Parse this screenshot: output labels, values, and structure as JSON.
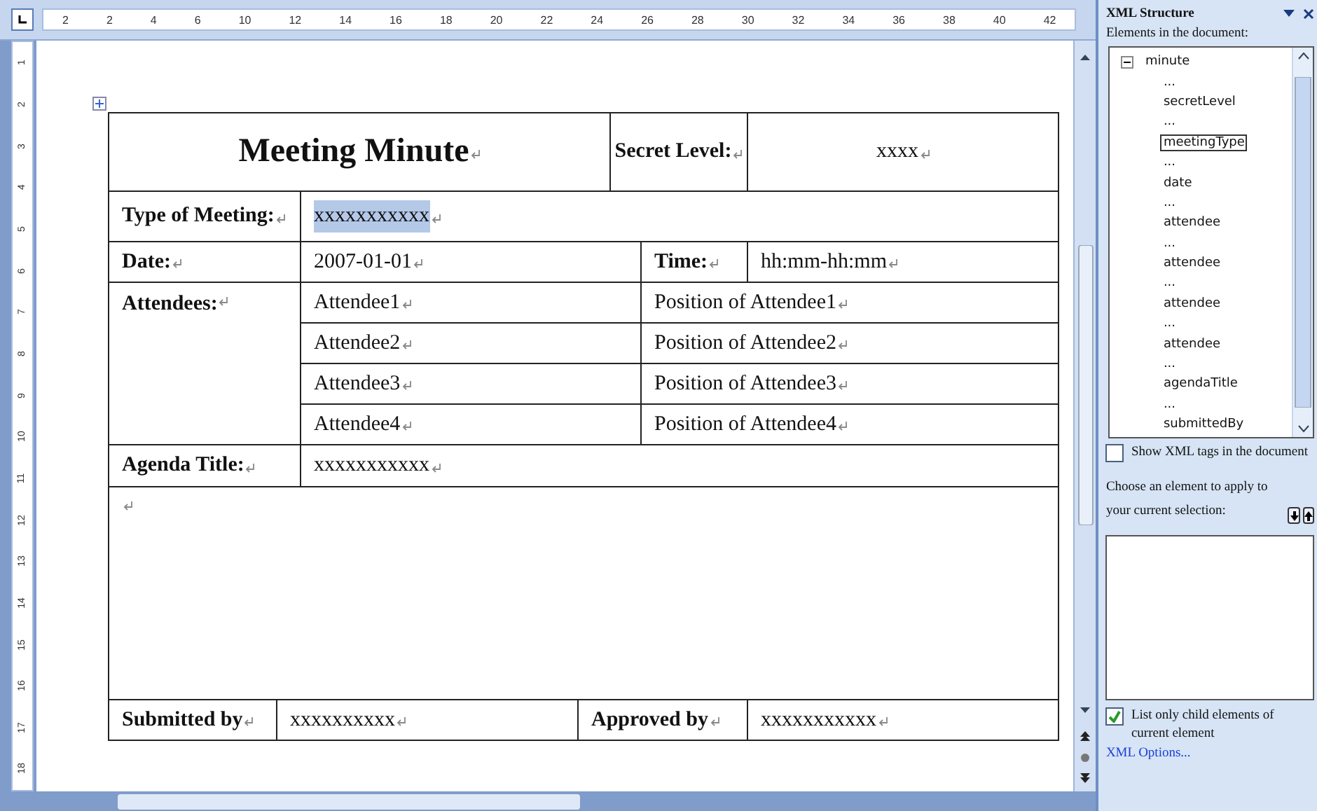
{
  "ruler": {
    "top_labels": [
      "2",
      "2",
      "4",
      "6",
      "10",
      "12",
      "14",
      "16",
      "18",
      "20",
      "22",
      "24",
      "26",
      "28",
      "30",
      "32",
      "34",
      "36",
      "38",
      "40",
      "42"
    ],
    "side_labels": [
      "1",
      "2",
      "3",
      "4",
      "5",
      "6",
      "7",
      "8",
      "9",
      "10",
      "11",
      "12",
      "13",
      "14",
      "15",
      "16",
      "17",
      "18"
    ]
  },
  "document": {
    "title": "Meeting Minute",
    "secret_level_label": "Secret Level:",
    "secret_level_value": "xxxx",
    "type_label": "Type of Meeting:",
    "type_value": {
      "text": "xxxxxxxxxxx",
      "highlighted": true
    },
    "date_label": "Date:",
    "date_value": "2007-01-01",
    "time_label": "Time:",
    "time_value": "hh:mm-hh:mm",
    "attendees_label": "Attendees:",
    "attendees": [
      {
        "name": "Attendee1",
        "position": "Position of Attendee1"
      },
      {
        "name": "Attendee2",
        "position": "Position of Attendee2"
      },
      {
        "name": "Attendee3",
        "position": "Position of Attendee3"
      },
      {
        "name": "Attendee4",
        "position": "Position of Attendee4"
      }
    ],
    "agenda_label": "Agenda Title:",
    "agenda_value": "xxxxxxxxxxx",
    "submitted_label": "Submitted by",
    "submitted_value": "xxxxxxxxxx",
    "approved_label": "Approved by",
    "approved_value": "xxxxxxxxxxx"
  },
  "xml_pane": {
    "title": "XML Structure",
    "elements_label": "Elements in the document:",
    "tree": {
      "label": "minute",
      "expanded": true,
      "children": [
        {
          "label": "...",
          "selected": false
        },
        {
          "label": "secretLevel",
          "selected": false
        },
        {
          "label": "...",
          "selected": false
        },
        {
          "label": "meetingType",
          "selected": true
        },
        {
          "label": "...",
          "selected": false
        },
        {
          "label": "date",
          "selected": false
        },
        {
          "label": "...",
          "selected": false
        },
        {
          "label": "attendee",
          "selected": false
        },
        {
          "label": "...",
          "selected": false
        },
        {
          "label": "attendee",
          "selected": false
        },
        {
          "label": "...",
          "selected": false
        },
        {
          "label": "attendee",
          "selected": false
        },
        {
          "label": "...",
          "selected": false
        },
        {
          "label": "attendee",
          "selected": false
        },
        {
          "label": "...",
          "selected": false
        },
        {
          "label": "agendaTitle",
          "selected": false
        },
        {
          "label": "...",
          "selected": false
        },
        {
          "label": "submittedBy",
          "selected": false
        }
      ]
    },
    "show_tags": {
      "label": "Show XML tags in the document",
      "checked": false
    },
    "choose_label": "Choose an element to apply to your current selection:",
    "list_only": {
      "label": "List only child elements of current element",
      "checked": true
    },
    "options_link": "XML Options..."
  }
}
